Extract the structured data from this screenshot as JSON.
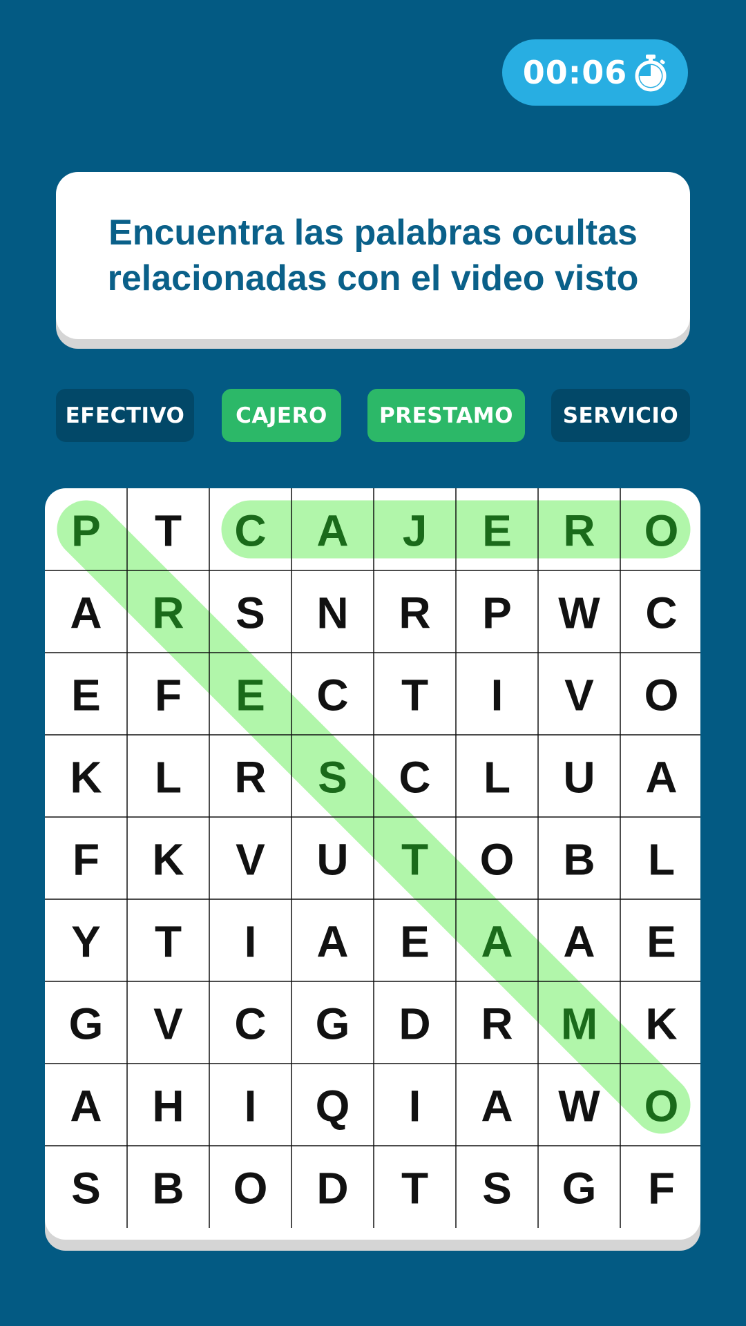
{
  "timer": {
    "time": "00:06",
    "icon": "stopwatch-icon"
  },
  "instructions": {
    "text": "Encuentra las palabras ocultas relacionadas con el video visto"
  },
  "words": [
    {
      "label": "EFECTIVO",
      "found": false
    },
    {
      "label": "CAJERO",
      "found": true
    },
    {
      "label": "PRESTAMO",
      "found": true
    },
    {
      "label": "SERVICIO",
      "found": false
    }
  ],
  "colors": {
    "background": "#035a83",
    "timer": "#28aee2",
    "chip_pending": "#024868",
    "chip_found": "#2cb868",
    "highlight": "#a3f59b",
    "found_letter": "#1a6a1a",
    "letter": "#111111"
  },
  "grid": {
    "rows": [
      [
        "P",
        "T",
        "C",
        "A",
        "J",
        "E",
        "R",
        "O"
      ],
      [
        "A",
        "R",
        "S",
        "N",
        "R",
        "P",
        "W",
        "C"
      ],
      [
        "E",
        "F",
        "E",
        "C",
        "T",
        "I",
        "V",
        "O"
      ],
      [
        "K",
        "L",
        "R",
        "S",
        "C",
        "L",
        "U",
        "A"
      ],
      [
        "F",
        "K",
        "V",
        "U",
        "T",
        "O",
        "B",
        "L"
      ],
      [
        "Y",
        "T",
        "I",
        "A",
        "E",
        "A",
        "A",
        "E"
      ],
      [
        "G",
        "V",
        "C",
        "G",
        "D",
        "R",
        "M",
        "K"
      ],
      [
        "A",
        "H",
        "I",
        "Q",
        "I",
        "A",
        "W",
        "O"
      ],
      [
        "S",
        "B",
        "O",
        "D",
        "T",
        "S",
        "G",
        "F"
      ]
    ],
    "highlights": [
      {
        "word": "CAJERO",
        "start": [
          0,
          2
        ],
        "end": [
          0,
          7
        ]
      },
      {
        "word": "PRESTAMO",
        "start": [
          0,
          0
        ],
        "end": [
          7,
          7
        ]
      }
    ]
  }
}
